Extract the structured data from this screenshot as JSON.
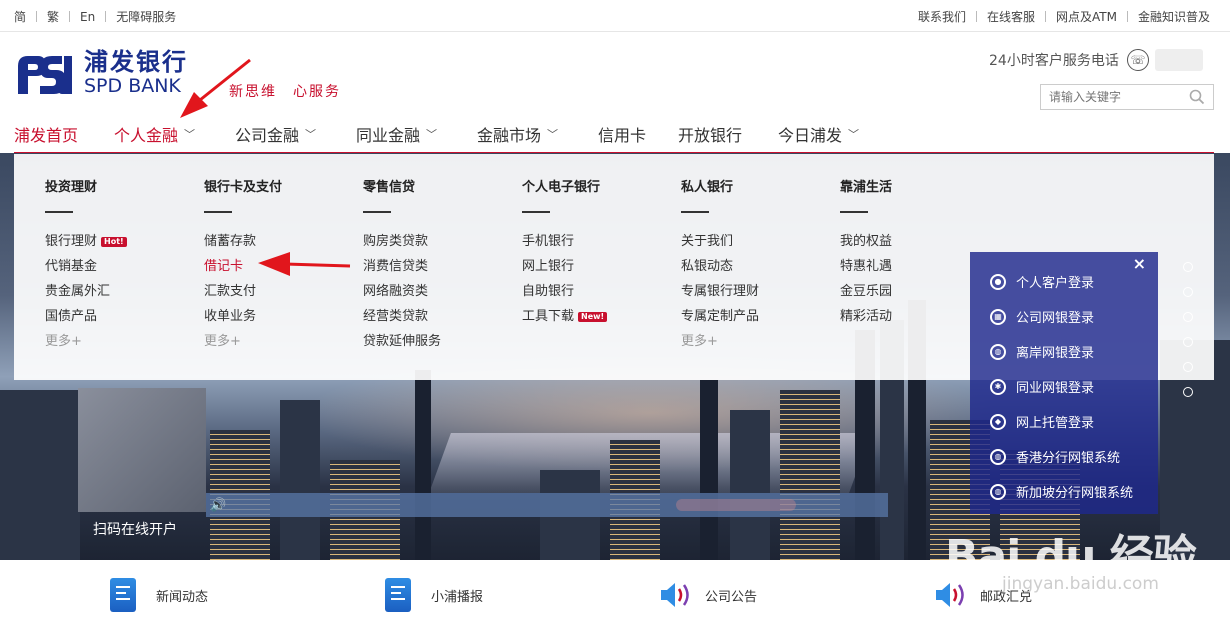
{
  "topbar": {
    "left": [
      "简",
      "繁",
      "En",
      "无障碍服务"
    ],
    "right": [
      "联系我们",
      "在线客服",
      "网点及ATM",
      "金融知识普及"
    ]
  },
  "brand": {
    "name_cn": "浦发银行",
    "name_en": "SPD BANK",
    "slogan": [
      "新思维",
      "心服务"
    ],
    "color": "#1a2f8c"
  },
  "hotline": {
    "label": "24小时客户服务电话"
  },
  "search": {
    "placeholder": "请输入关键字"
  },
  "nav": {
    "items": [
      {
        "label": "浦发首页",
        "dropdown": false
      },
      {
        "label": "个人金融",
        "dropdown": true,
        "active": true
      },
      {
        "label": "公司金融",
        "dropdown": true
      },
      {
        "label": "同业金融",
        "dropdown": true
      },
      {
        "label": "金融市场",
        "dropdown": true
      },
      {
        "label": "信用卡",
        "dropdown": false
      },
      {
        "label": "开放银行",
        "dropdown": false
      },
      {
        "label": "今日浦发",
        "dropdown": true
      }
    ],
    "accent": "#c8102e"
  },
  "mega_menu": {
    "columns": [
      {
        "title": "投资理财",
        "links": [
          "银行理财",
          "代销基金",
          "贵金属外汇",
          "国债产品"
        ],
        "badges": {
          "0": "Hot!"
        },
        "more": "更多+"
      },
      {
        "title": "银行卡及支付",
        "links": [
          "储蓄存款",
          "借记卡",
          "汇款支付",
          "收单业务"
        ],
        "highlight": 1,
        "more": "更多+"
      },
      {
        "title": "零售信贷",
        "links": [
          "购房类贷款",
          "消费信贷类",
          "网络融资类",
          "经营类贷款",
          "贷款延伸服务"
        ]
      },
      {
        "title": "个人电子银行",
        "links": [
          "手机银行",
          "网上银行",
          "自助银行",
          "工具下载"
        ],
        "badges": {
          "3": "New!"
        }
      },
      {
        "title": "私人银行",
        "links": [
          "关于我们",
          "私银动态",
          "专属银行理财",
          "专属定制产品"
        ],
        "more": "更多+"
      },
      {
        "title": "靠浦生活",
        "links": [
          "我的权益",
          "特惠礼遇",
          "金豆乐园",
          "精彩活动"
        ]
      }
    ]
  },
  "login_panel": {
    "close": "×",
    "entries": [
      "个人客户登录",
      "公司网银登录",
      "离岸网银登录",
      "同业网银登录",
      "网上托管登录",
      "香港分行网银系统",
      "新加坡分行网银系统"
    ]
  },
  "hero": {
    "qr_label": "扫码在线开户"
  },
  "bottom": {
    "items": [
      "新闻动态",
      "小浦播报",
      "公司公告",
      "邮政汇兑"
    ]
  },
  "watermark": {
    "text": "Bai du 经验",
    "url": "jingyan.baidu.com"
  }
}
